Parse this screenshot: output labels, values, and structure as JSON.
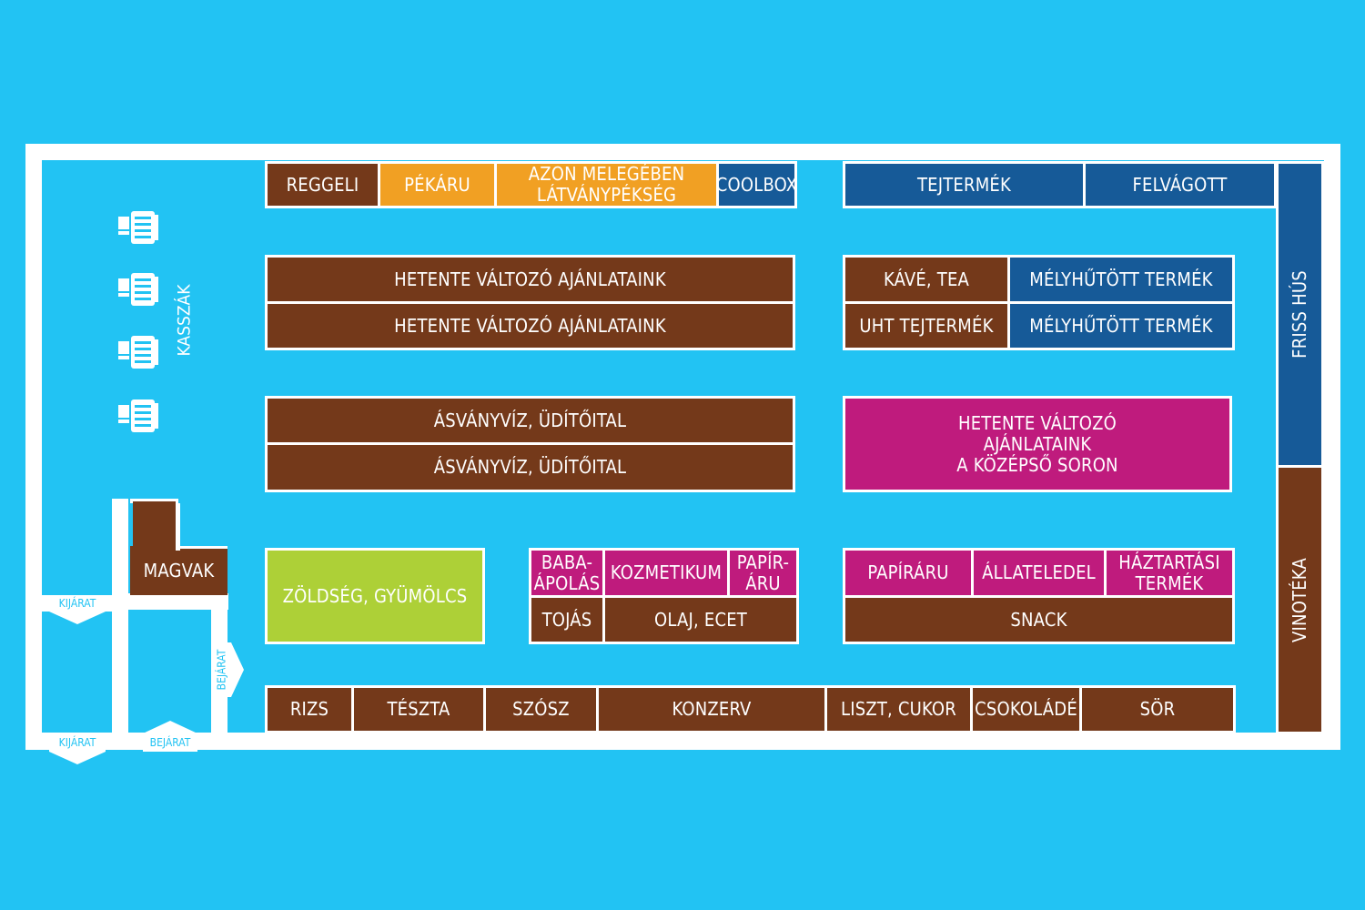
{
  "colors": {
    "background": "#22c3f3",
    "wall": "#ffffff",
    "brown": "#74391a",
    "orange": "#f1a023",
    "navy": "#165a98",
    "magenta": "#bf1b7d",
    "lime": "#add037"
  },
  "checkout": {
    "label": "KASSZÁK",
    "register_icon": "cash-register-icon",
    "register_count": 4
  },
  "doors": {
    "exit_1": "KIJÁRAT",
    "exit_2": "KIJÁRAT",
    "entrance_1": "BEJÁRAT",
    "entrance_2": "BEJÁRAT"
  },
  "sections": {
    "reggeli": "REGGELI",
    "pekaru": "PÉKÁRU",
    "azon": "AZON MELEGÉBEN\nLÁTVÁNYPÉKSÉG",
    "coolbox": "COOLBOX",
    "tejtermek": "TEJTERMÉK",
    "felvagott": "FELVÁGOTT",
    "friss_hus": "FRISS HÚS",
    "vinoteka": "VINOTÉKA",
    "hetente_1": "HETENTE VÁLTOZÓ AJÁNLATAINK",
    "hetente_2": "HETENTE VÁLTOZÓ AJÁNLATAINK",
    "kave_tea": "KÁVÉ, TEA",
    "mely_1": "MÉLYHŰTÖTT TERMÉK",
    "uht": "UHT TEJTERMÉK",
    "mely_2": "MÉLYHŰTÖTT TERMÉK",
    "asvany_1": "ÁSVÁNYVÍZ, ÜDÍTŐITAL",
    "asvany_2": "ÁSVÁNYVÍZ, ÜDÍTŐITAL",
    "hetente_kozepso": "HETENTE VÁLTOZÓ\nAJÁNLATAINK\nA KÖZÉPSŐ SORON",
    "magvak": "MAGVAK",
    "zoldseg": "ZÖLDSÉG, GYÜMÖLCS",
    "babaapolas": "BABA-\nÁPOLÁS",
    "kozmetikum": "KOZMETIKUM",
    "papiraru_small": "PAPÍR-\nÁRU",
    "tojas": "TOJÁS",
    "olaj": "OLAJ, ECET",
    "papiraru": "PAPÍRÁRU",
    "allateledel": "ÁLLATELEDEL",
    "haztartasi": "HÁZTARTÁSI\nTERMÉK",
    "snack": "SNACK",
    "rizs": "RIZS",
    "teszta": "TÉSZTA",
    "szosz": "SZÓSZ",
    "konzerv": "KONZERV",
    "liszt": "LISZT, CUKOR",
    "csokolade": "CSOKOLÁDÉ",
    "sor": "SÖR"
  }
}
